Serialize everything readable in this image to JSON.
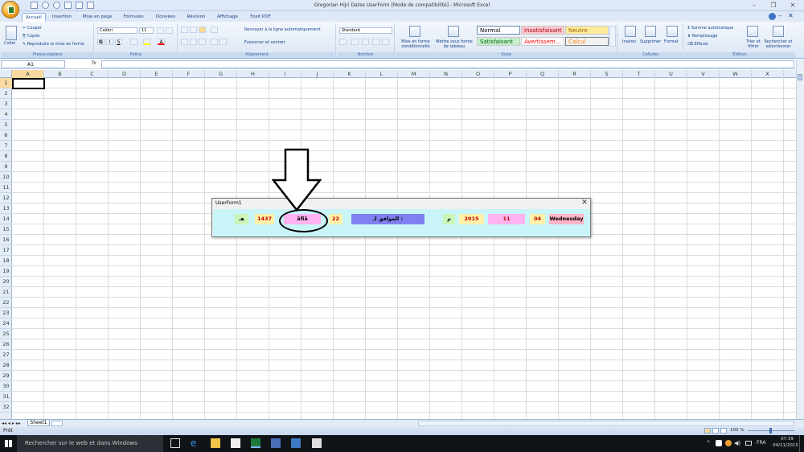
{
  "window": {
    "title": "Gregorian Hijri Dates UserForm  [Mode de compatibilité] - Microsoft Excel"
  },
  "tabs": [
    "Accueil",
    "Insertion",
    "Mise en page",
    "Formules",
    "Données",
    "Révision",
    "Affichage",
    "Foxit PDF"
  ],
  "ribbon": {
    "clipboard": {
      "paste": "Coller",
      "cut": "Couper",
      "copy": "Copier",
      "format_painter": "Reproduire la mise en forme",
      "group": "Presse-papiers"
    },
    "font": {
      "name": "Calibri",
      "size": "11",
      "group": "Police"
    },
    "alignment": {
      "wrap": "Renvoyer à la ligne automatiquement",
      "merge": "Fusionner et centrer",
      "group": "Alignement"
    },
    "number": {
      "format": "Standard",
      "group": "Nombre"
    },
    "styles": {
      "cond_format": "Mise en forme conditionnelle",
      "table_format": "Mettre sous forme de tableau",
      "normal": "Normal",
      "bad": "Insatisfaisant",
      "neutral": "Neutre",
      "good": "Satisfaisant",
      "warning": "Avertissem...",
      "calc": "Calcul",
      "group": "Style"
    },
    "cells": {
      "insert": "Insérer",
      "delete": "Supprimer",
      "format": "Format",
      "group": "Cellules"
    },
    "editing": {
      "autosum": "Somme automatique",
      "fill": "Remplissage",
      "clear": "Effacer",
      "sort": "Trier et filtrer",
      "find": "Rechercher et sélectionner",
      "group": "Édition"
    }
  },
  "formula_bar": {
    "name_box": "A1",
    "fx": "fx"
  },
  "columns": [
    "A",
    "B",
    "C",
    "D",
    "E",
    "F",
    "G",
    "H",
    "I",
    "J",
    "K",
    "L",
    "M",
    "N",
    "O",
    "P",
    "Q",
    "R",
    "S",
    "T",
    "U",
    "V",
    "W",
    "X"
  ],
  "rows": [
    "1",
    "2",
    "3",
    "4",
    "5",
    "6",
    "7",
    "8",
    "9",
    "10",
    "11",
    "12",
    "13",
    "14",
    "15",
    "16",
    "17",
    "18",
    "19",
    "20",
    "21",
    "22",
    "23",
    "24",
    "25",
    "26",
    "27",
    "28",
    "29",
    "30",
    "31",
    "32"
  ],
  "sheet": {
    "tab": "Sheet1"
  },
  "status": {
    "ready": "Prêt",
    "zoom": "100 %"
  },
  "taskbar": {
    "search": "Rechercher sur le web et dans Windows",
    "lang": "FRA",
    "time": "07:39",
    "date": "04/11/2015"
  },
  "userform": {
    "title": "UserForm1",
    "hijri_suffix": "هـ",
    "hijri_year": "1437",
    "hijri_month": "āfiā",
    "hijri_day": "22",
    "corresponds": "الموافق لـ :",
    "greg_suffix": "م",
    "greg_year": "2015",
    "greg_month": "11",
    "greg_day": "04",
    "weekday": "Wednesday"
  },
  "colors": {
    "normal_bg": "#ffffff",
    "bad_bg": "#ffc7ce",
    "neutral_bg": "#ffeb9c",
    "good_bg": "#c6efce",
    "form_bg": "#c9f5f9",
    "month_bg": "#ffb3f0",
    "corr_bg": "#8080f0",
    "year_bg": "#fff2a8",
    "green_bg": "#ccf5b8",
    "weekday_bg": "#ffb4c8"
  }
}
